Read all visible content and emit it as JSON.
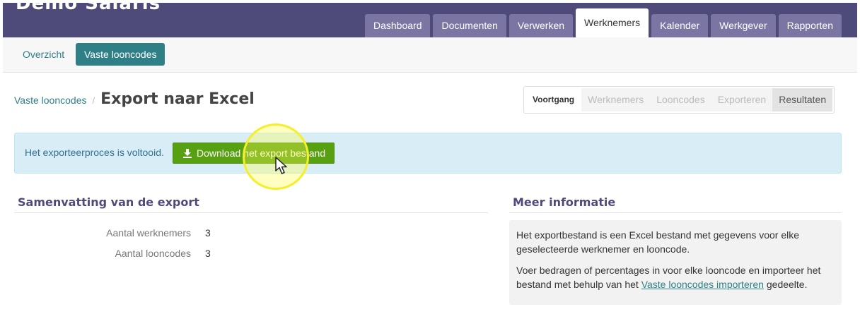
{
  "app": {
    "title": "Demo Salaris"
  },
  "main_nav": [
    "Dashboard",
    "Documenten",
    "Verwerken",
    "Werknemers",
    "Kalender",
    "Werkgever",
    "Rapporten"
  ],
  "sub_nav": [
    "Overzicht",
    "Vaste looncodes"
  ],
  "breadcrumb": {
    "parent": "Vaste looncodes",
    "separator": "/",
    "current": "Export naar Excel"
  },
  "steps": {
    "label": "Voortgang",
    "items": [
      "Werknemers",
      "Looncodes",
      "Exporteren",
      "Resultaten"
    ]
  },
  "alert": {
    "text": "Het exporteerproces is voltooid.",
    "button": "Download het export bestand",
    "button_icon": "download-icon"
  },
  "summary": {
    "title": "Samenvatting van de export",
    "rows": [
      {
        "label": "Aantal werknemers",
        "value": "3"
      },
      {
        "label": "Aantal looncodes",
        "value": "3"
      }
    ]
  },
  "info": {
    "title": "Meer informatie",
    "p1": "Het exportbestand is een Excel bestand met gegevens voor elke geselecteerde werknemer en looncode.",
    "p2_before": "Voer bedragen of percentages in voor elke looncode en importeer het bestand met behulp van het ",
    "p2_link": "Vaste looncodes importeren",
    "p2_after": " gedeelte."
  },
  "colors": {
    "header": "#4e4a7a",
    "accent": "#2f7f86",
    "success": "#57a011",
    "alert_bg": "#d9edf7"
  }
}
